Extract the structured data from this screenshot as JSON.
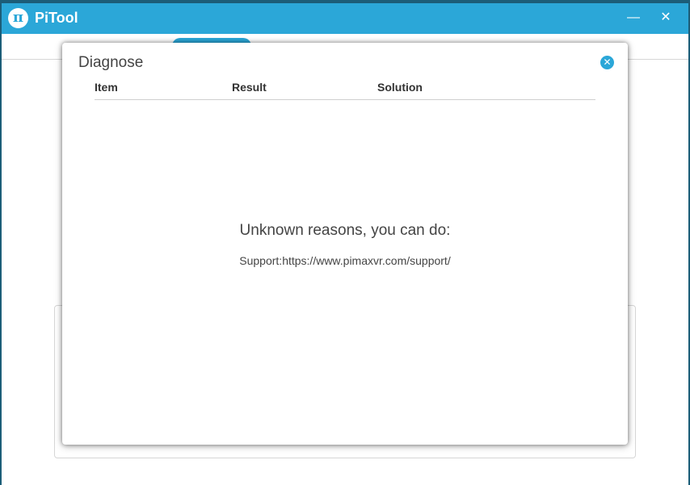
{
  "app": {
    "title": "PiTool",
    "logo_glyph": "π",
    "minimize_glyph": "—",
    "close_glyph": "✕"
  },
  "dialog": {
    "title": "Diagnose",
    "close_glyph": "✕",
    "columns": [
      "Item",
      "Result",
      "Solution"
    ],
    "message": "Unknown reasons, you can do:",
    "support": "Support:https://www.pimaxvr.com/support/"
  },
  "colors": {
    "accent": "#2ba7d8",
    "desktop": "#1c5d78",
    "text": "#444444"
  },
  "icons": {
    "logo": "pi-logo-icon",
    "minimize": "minimize-icon",
    "close": "close-icon",
    "dialog_close": "close-circle-icon"
  }
}
